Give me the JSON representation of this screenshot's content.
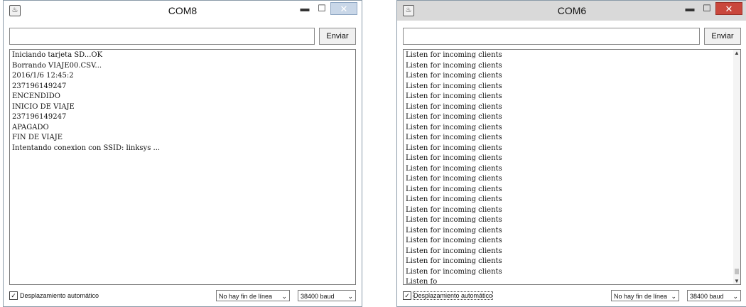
{
  "windows": [
    {
      "title": "COM8",
      "send_button": "Enviar",
      "send_input_value": "",
      "output_lines": [
        "Iniciando tarjeta SD...OK",
        "Borrando VIAJE00.CSV...",
        "2016/1/6 12:45:2",
        "237196149247",
        "ENCENDIDO",
        "INICIO DE VIAJE",
        "237196149247",
        "APAGADO",
        "FIN DE VIAJE",
        "Intentando conexion con SSID: linksys ..."
      ],
      "autoscroll_label": "Desplazamiento automático",
      "autoscroll_checked": true,
      "line_ending": "No hay fin de línea",
      "baud": "38400 baud"
    },
    {
      "title": "COM6",
      "send_button": "Enviar",
      "send_input_value": "",
      "output_lines": [
        "Listen for incoming clients",
        "Listen for incoming clients",
        "Listen for incoming clients",
        "Listen for incoming clients",
        "Listen for incoming clients",
        "Listen for incoming clients",
        "Listen for incoming clients",
        "Listen for incoming clients",
        "Listen for incoming clients",
        "Listen for incoming clients",
        "Listen for incoming clients",
        "Listen for incoming clients",
        "Listen for incoming clients",
        "Listen for incoming clients",
        "Listen for incoming clients",
        "Listen for incoming clients",
        "Listen for incoming clients",
        "Listen for incoming clients",
        "Listen for incoming clients",
        "Listen for incoming clients",
        "Listen for incoming clients",
        "Listen for incoming clients",
        "Listen fo"
      ],
      "autoscroll_label": "Desplazamiento automático",
      "autoscroll_checked": true,
      "line_ending": "No hay fin de línea",
      "baud": "38400 baud"
    }
  ],
  "icons": {
    "app": "arduino-app-icon",
    "minimize": "minimize-icon",
    "maximize": "maximize-icon",
    "close": "close-icon",
    "dropdown": "chevron-down-icon",
    "scroll_up": "scroll-up-arrow-icon",
    "scroll_down": "scroll-down-arrow-icon"
  },
  "colors": {
    "close_button_active": "#c9473c",
    "close_button_inactive": "#c9d7e8",
    "titlebar_inactive": "#d9d9d9"
  }
}
